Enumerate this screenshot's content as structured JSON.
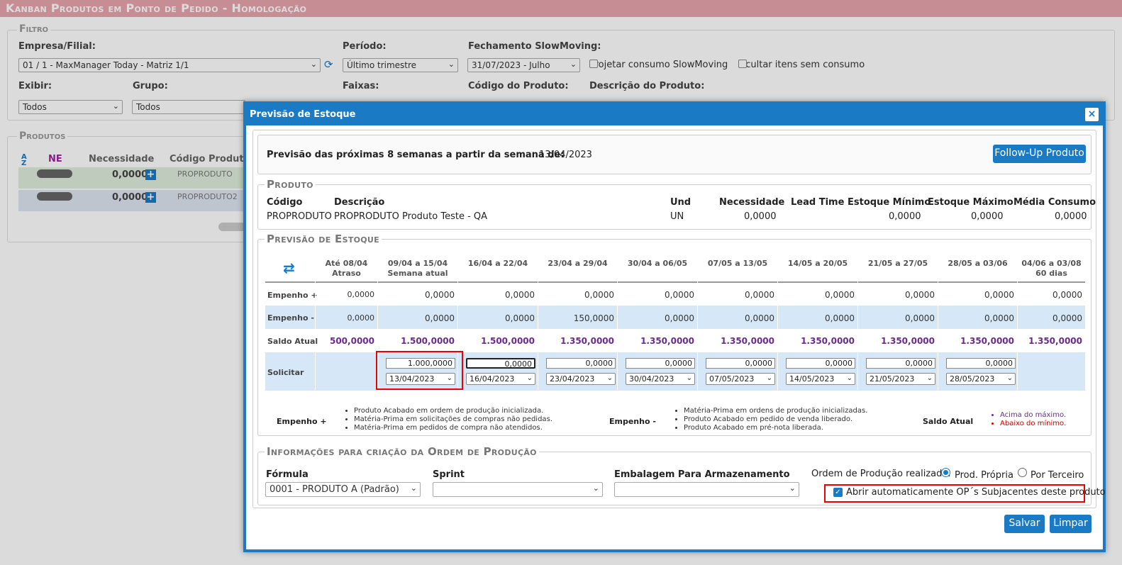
{
  "app": {
    "title": "Kanban Produtos em Ponto de Pedido  - Homologação"
  },
  "filtro": {
    "legend": "Filtro",
    "empresa_label": "Empresa/Filial:",
    "empresa_value": "01 / 1 - MaxManager Today - Matriz 1/1",
    "periodo_label": "Período:",
    "periodo_value": "Último trimestre",
    "fechamento_label": "Fechamento SlowMoving:",
    "fechamento_value": "31/07/2023 - Julho",
    "projetar_label": "Projetar consumo SlowMoving",
    "ocultar_label": "Ocultar itens sem consumo",
    "exibir_label": "Exibir:",
    "exibir_value": "Todos",
    "grupo_label": "Grupo:",
    "grupo_value": "Todos",
    "faixas_label": "Faixas:",
    "codigo_label": "Código do Produto:",
    "descricao_label": "Descrição do Produto:"
  },
  "produtos": {
    "legend": "Produtos",
    "col_ne": "NE",
    "col_necessidade": "Necessidade",
    "col_codigo": "Código Produto",
    "rows": [
      {
        "necessidade": "0,0000",
        "codigo": "PROPRODUTO"
      },
      {
        "necessidade": "0,0000",
        "codigo": "PROPRODUTO2"
      }
    ]
  },
  "dialog": {
    "title": "Previsão de Estoque",
    "close": "×",
    "previsao_label": "Previsão das próximas 8 semanas a partir da semana de:",
    "previsao_date": "13/04/2023",
    "followup_button": "Follow-Up Produto",
    "produto": {
      "legend": "Produto",
      "headers": {
        "codigo": "Código",
        "descricao": "Descrição",
        "und": "Und",
        "necessidade": "Necessidade",
        "lead_time": "Lead Time",
        "estoque_min": "Estoque Mínimo",
        "estoque_max": "Estoque Máximo",
        "media": "Média Consumo"
      },
      "values": {
        "codigo": "PROPRODUTO",
        "descricao": "PROPRODUTO Produto Teste - QA",
        "und": "UN",
        "necessidade": "0,0000",
        "lead_time": "",
        "estoque_min": "0,0000",
        "estoque_max": "0,0000",
        "media": "0,0000"
      }
    },
    "previsao": {
      "legend": "Previsão de Estoque",
      "columns": [
        {
          "h1": "Até 08/04",
          "h2": "Atraso",
          "empenho_mais": "0,0000",
          "empenho_menos": "0,0000",
          "saldo": "500,0000",
          "qty": "",
          "date": ""
        },
        {
          "h1": "09/04 a 15/04",
          "h2": "Semana atual",
          "empenho_mais": "0,0000",
          "empenho_menos": "0,0000",
          "saldo": "1.500,0000",
          "qty": "1.000,0000",
          "date": "13/04/2023"
        },
        {
          "h1": "16/04 a 22/04",
          "h2": "",
          "empenho_mais": "0,0000",
          "empenho_menos": "0,0000",
          "saldo": "1.500,0000",
          "qty": "0,0000",
          "date": "16/04/2023"
        },
        {
          "h1": "23/04 a 29/04",
          "h2": "",
          "empenho_mais": "0,0000",
          "empenho_menos": "150,0000",
          "saldo": "1.350,0000",
          "qty": "0,0000",
          "date": "23/04/2023"
        },
        {
          "h1": "30/04 a 06/05",
          "h2": "",
          "empenho_mais": "0,0000",
          "empenho_menos": "0,0000",
          "saldo": "1.350,0000",
          "qty": "0,0000",
          "date": "30/04/2023"
        },
        {
          "h1": "07/05 a 13/05",
          "h2": "",
          "empenho_mais": "0,0000",
          "empenho_menos": "0,0000",
          "saldo": "1.350,0000",
          "qty": "0,0000",
          "date": "07/05/2023"
        },
        {
          "h1": "14/05 a 20/05",
          "h2": "",
          "empenho_mais": "0,0000",
          "empenho_menos": "0,0000",
          "saldo": "1.350,0000",
          "qty": "0,0000",
          "date": "14/05/2023"
        },
        {
          "h1": "21/05 a 27/05",
          "h2": "",
          "empenho_mais": "0,0000",
          "empenho_menos": "0,0000",
          "saldo": "1.350,0000",
          "qty": "0,0000",
          "date": "21/05/2023"
        },
        {
          "h1": "28/05 a 03/06",
          "h2": "",
          "empenho_mais": "0,0000",
          "empenho_menos": "0,0000",
          "saldo": "1.350,0000",
          "qty": "0,0000",
          "date": "28/05/2023"
        },
        {
          "h1": "04/06 a 03/08",
          "h2": "60 dias",
          "empenho_mais": "0,0000",
          "empenho_menos": "0,0000",
          "saldo": "1.350,0000",
          "qty": "",
          "date": ""
        }
      ],
      "row_labels": {
        "empenho_mais": "Empenho +",
        "empenho_menos": "Empenho -",
        "saldo": "Saldo Atual",
        "solicitar": "Solicitar"
      },
      "legend_empenho_mais": {
        "label": "Empenho +",
        "items": [
          "Produto Acabado em ordem de produção inicializada.",
          "Matéria-Prima em solicitações de compras não pedidas.",
          "Matéria-Prima em pedidos de compra não atendidos."
        ]
      },
      "legend_empenho_menos": {
        "label": "Empenho -",
        "items": [
          "Matéria-Prima em ordens de produção inicializadas.",
          "Produto Acabado em pedido de venda liberado.",
          "Produto Acabado em pré-nota liberada."
        ]
      },
      "legend_saldo": {
        "label": "Saldo Atual",
        "items": [
          "Acima do máximo.",
          "Abaixo do mínimo."
        ]
      },
      "colors": {
        "purple": "#6a2c8c",
        "red": "#cc0000",
        "blue_row": "#d6e8f7"
      }
    },
    "info": {
      "legend": "Informações para criação da Ordem de Produção",
      "formula_label": "Fórmula",
      "formula_value": "0001 - PRODUTO A (Padrão)",
      "sprint_label": "Sprint",
      "sprint_value": "",
      "embalagem_label": "Embalagem Para Armazenamento",
      "embalagem_value": "",
      "ordem_label": "Ordem de Produção realizada:",
      "radio_propria": "Prod. Própria",
      "radio_terceiro": "Por Terceiro",
      "abrir_label": "Abrir automaticamente OP´s Subjacentes deste produto"
    },
    "salvar_button": "Salvar",
    "limpar_button": "Limpar"
  }
}
